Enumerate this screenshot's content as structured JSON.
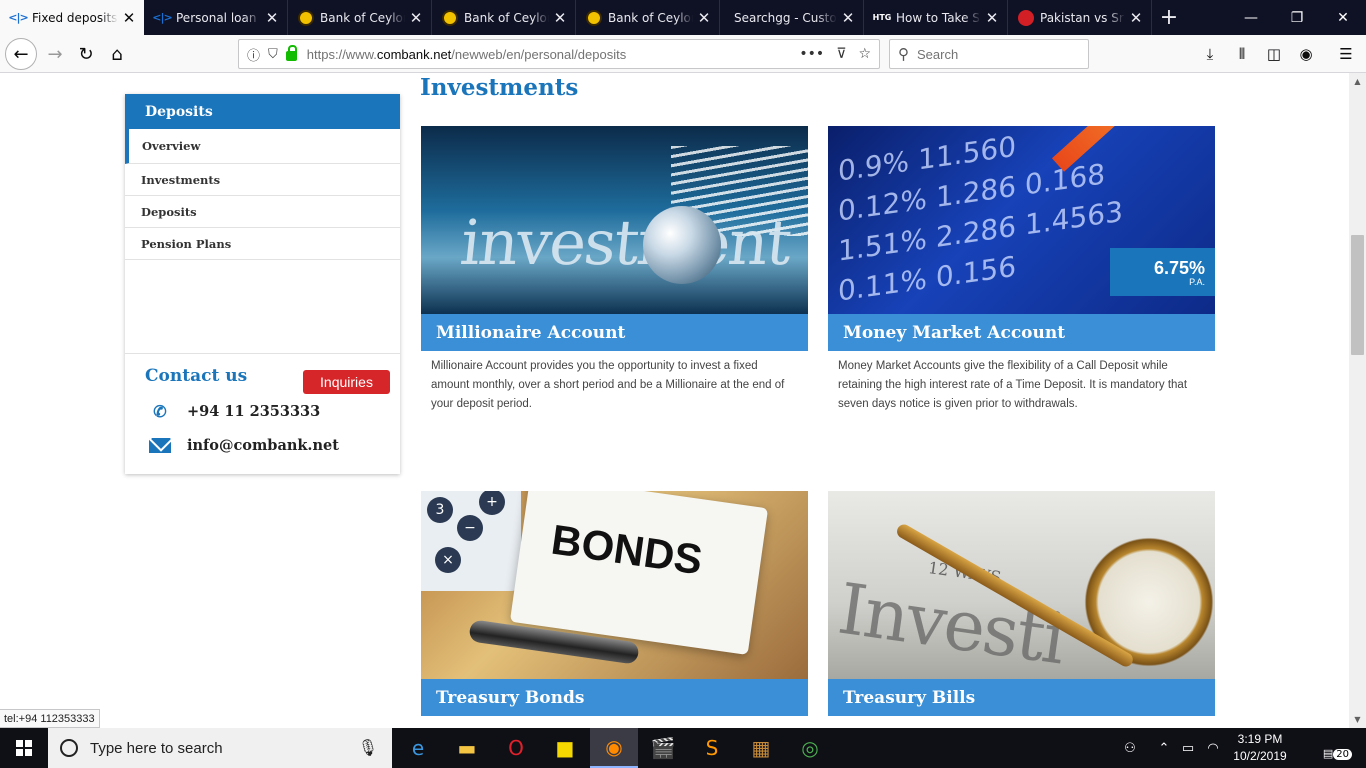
{
  "browser": {
    "tabs": [
      {
        "title": "Fixed deposits | ",
        "favicon": "combank-icon",
        "active": true
      },
      {
        "title": "Personal loan | ",
        "favicon": "combank-icon",
        "active": false
      },
      {
        "title": "Bank of Ceylon",
        "favicon": "boc-icon",
        "active": false
      },
      {
        "title": "Bank of Ceylon",
        "favicon": "boc-icon",
        "active": false
      },
      {
        "title": "Bank of Ceylon",
        "favicon": "boc-icon",
        "active": false
      },
      {
        "title": "Searchgg - Custom",
        "favicon": "blank-icon",
        "active": false
      },
      {
        "title": "How to Take Sc",
        "favicon": "htg-icon",
        "active": false
      },
      {
        "title": "Pakistan vs Sri L",
        "favicon": "cricket-icon",
        "active": false
      }
    ],
    "url_prefix": "https://www.",
    "url_domain": "combank.net",
    "url_path": "/newweb/en/personal/deposits",
    "search_placeholder": "Search",
    "status_link": "tel:+94 112353333"
  },
  "sidebar": {
    "heading": "Deposits",
    "items": [
      {
        "label": "Overview",
        "active": true
      },
      {
        "label": "Investments",
        "active": false
      },
      {
        "label": "Deposits",
        "active": false
      },
      {
        "label": "Pension Plans",
        "active": false
      }
    ],
    "contact_title": "Contact us",
    "inquiries_label": "Inquiries",
    "phone": "+94 11 2353333",
    "email": "info@combank.net"
  },
  "main": {
    "title": "Investments",
    "cards": [
      {
        "title": "Millionaire Account",
        "image_word": "investment",
        "description": "Millionaire Account provides you the opportunity to invest a fixed amount monthly, over a short period and be a Millionaire at the end of your deposit period."
      },
      {
        "title": "Money Market Account",
        "rate": "6.75%",
        "rate_unit": "P.A.",
        "description": "Money Market Accounts give the flexibility of a Call Deposit while retaining the high interest rate of a Time Deposit. It is mandatory that seven days notice  is given prior to withdrawals."
      },
      {
        "title": "Treasury Bonds",
        "image_word": "BONDS",
        "description": ""
      },
      {
        "title": "Treasury Bills",
        "image_word": "Investi",
        "image_small": "12 WAYS",
        "description": ""
      }
    ]
  },
  "taskbar": {
    "search_placeholder": "Type here to search",
    "time": "3:19 PM",
    "date": "10/2/2019",
    "notification_count": "20"
  },
  "colors": {
    "brand_blue": "#1a75bb",
    "banner_blue": "#3a8fd6",
    "inquiries_red": "#d7262a"
  }
}
